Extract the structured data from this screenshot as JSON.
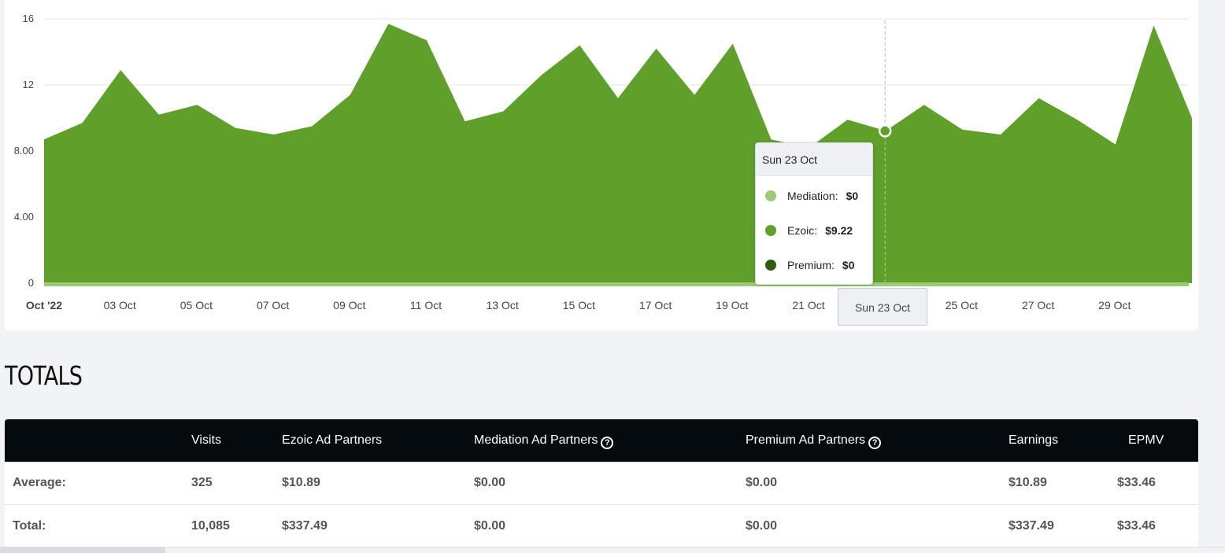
{
  "chart_data": {
    "type": "area",
    "y_ticks": [
      "16",
      "12",
      "8.00",
      "4.00",
      "0"
    ],
    "ylim": [
      0,
      16
    ],
    "x_tick_labels": [
      "Oct '22",
      "03 Oct",
      "05 Oct",
      "07 Oct",
      "09 Oct",
      "11 Oct",
      "13 Oct",
      "15 Oct",
      "17 Oct",
      "19 Oct",
      "21 Oct",
      "Sun 23 Oct",
      "25 Oct",
      "27 Oct",
      "29 Oct"
    ],
    "days": [
      1,
      2,
      3,
      4,
      5,
      6,
      7,
      8,
      9,
      10,
      11,
      12,
      13,
      14,
      15,
      16,
      17,
      18,
      19,
      20,
      21,
      22,
      23,
      24,
      25,
      26,
      27,
      28,
      29,
      30,
      31
    ],
    "series": [
      {
        "name": "Premium",
        "color": "#2f5c12",
        "values": [
          0,
          0,
          0,
          0,
          0,
          0,
          0,
          0,
          0,
          0,
          0,
          0,
          0,
          0,
          0,
          0,
          0,
          0,
          0,
          0,
          0,
          0,
          0,
          0,
          0,
          0,
          0,
          0,
          0,
          0,
          0
        ]
      },
      {
        "name": "Ezoic",
        "color": "#5fa02b",
        "values": [
          8.7,
          9.7,
          12.9,
          10.2,
          10.8,
          9.4,
          9.0,
          9.5,
          11.4,
          15.7,
          14.7,
          9.8,
          10.4,
          12.6,
          14.4,
          11.2,
          14.2,
          11.4,
          14.5,
          8.7,
          8.2,
          9.9,
          9.22,
          10.8,
          9.3,
          9.0,
          11.2,
          9.9,
          8.4,
          15.6,
          10.0
        ]
      },
      {
        "name": "Mediation",
        "color": "#9cc97a",
        "values": [
          0,
          0,
          0,
          0,
          0,
          0,
          0,
          0,
          0,
          0,
          0,
          0,
          0,
          0,
          0,
          0,
          0,
          0,
          0,
          0,
          0,
          0,
          0,
          0,
          0,
          0,
          0,
          0,
          0,
          0,
          0
        ]
      }
    ],
    "highlight_day": 23
  },
  "tooltip": {
    "title": "Sun 23 Oct",
    "rows": [
      {
        "label": "Mediation:",
        "value": "$0",
        "color": "#9cc97a"
      },
      {
        "label": "Ezoic:",
        "value": "$9.22",
        "color": "#5fa02b"
      },
      {
        "label": "Premium:",
        "value": "$0",
        "color": "#2f5c12"
      }
    ]
  },
  "totals": {
    "title": "TOTALS",
    "headers": [
      "Visits",
      "Ezoic Ad Partners",
      "Mediation Ad Partners",
      "Premium Ad Partners",
      "Earnings",
      "EPMV"
    ],
    "rows": [
      {
        "label": "Average:",
        "cells": [
          "325",
          "$10.89",
          "$0.00",
          "$0.00",
          "$10.89",
          "$33.46"
        ]
      },
      {
        "label": "Total:",
        "cells": [
          "10,085",
          "$337.49",
          "$0.00",
          "$0.00",
          "$337.49",
          "$33.46"
        ]
      }
    ]
  }
}
